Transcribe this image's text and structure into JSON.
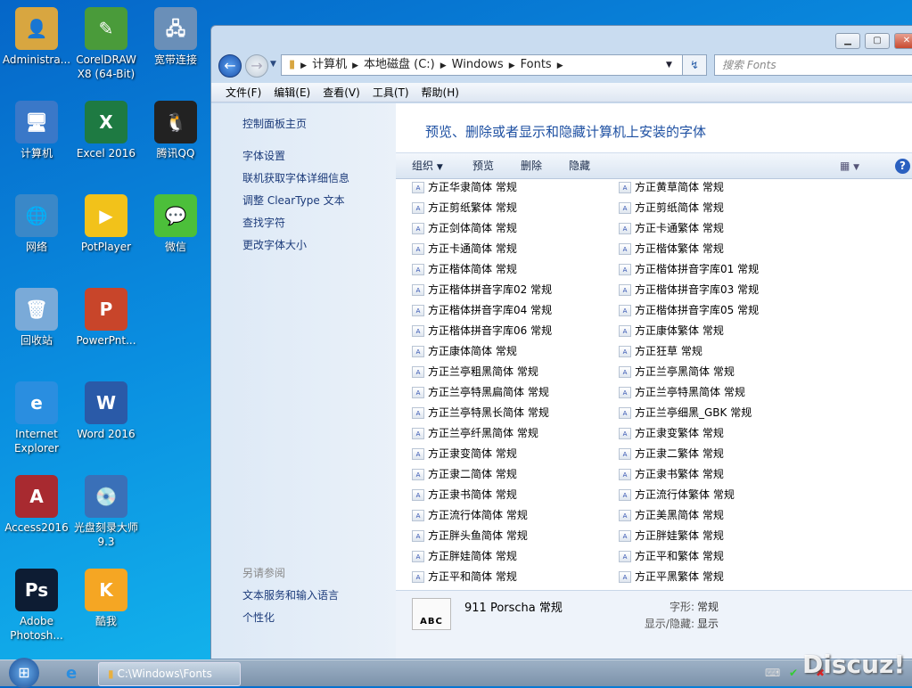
{
  "desktop": {
    "icons": [
      {
        "label": "Administra...",
        "icon": "user-folder-icon",
        "color": "#d8a640",
        "glyph": "👤"
      },
      {
        "label": "CorelDRAW X8 (64-Bit)",
        "icon": "coreldraw-icon",
        "color": "#4a9b3a",
        "glyph": "✎"
      },
      {
        "label": "宽带连接",
        "icon": "broadband-icon",
        "color": "#6a8fb8",
        "glyph": "🖧"
      },
      {
        "label": "计算机",
        "icon": "computer-icon",
        "color": "#3a78c8",
        "glyph": "🖥"
      },
      {
        "label": "Excel 2016",
        "icon": "excel-icon",
        "color": "#1e7a42",
        "glyph": "X"
      },
      {
        "label": "腾讯QQ",
        "icon": "qq-icon",
        "color": "#222",
        "glyph": "🐧"
      },
      {
        "label": "网络",
        "icon": "network-icon",
        "color": "#3a88c8",
        "glyph": "🌐"
      },
      {
        "label": "PotPlayer",
        "icon": "potplayer-icon",
        "color": "#f2c21a",
        "glyph": "▶"
      },
      {
        "label": "微信",
        "icon": "wechat-icon",
        "color": "#4cbf3a",
        "glyph": "💬"
      },
      {
        "label": "回收站",
        "icon": "recycle-bin-icon",
        "color": "#7aaad8",
        "glyph": "🗑"
      },
      {
        "label": "PowerPnt...",
        "icon": "powerpoint-icon",
        "color": "#c8452a",
        "glyph": "P"
      },
      {
        "label": "Internet Explorer",
        "icon": "ie-icon",
        "color": "#2a8ee0",
        "glyph": "e"
      },
      {
        "label": "Word 2016",
        "icon": "word-icon",
        "color": "#2a5aa8",
        "glyph": "W"
      },
      {
        "label": "Access2016",
        "icon": "access-icon",
        "color": "#a82a30",
        "glyph": "A"
      },
      {
        "label": "光盘刻录大师 9.3",
        "icon": "disc-burner-icon",
        "color": "#3a70b8",
        "glyph": "💿"
      },
      {
        "label": "Adobe Photosh...",
        "icon": "photoshop-icon",
        "color": "#0d1c33",
        "glyph": "Ps"
      },
      {
        "label": "酷我",
        "icon": "kuwo-icon",
        "color": "#f5a623",
        "glyph": "K"
      }
    ]
  },
  "window": {
    "nav": {
      "breadcrumb": [
        "计算机",
        "本地磁盘 (C:)",
        "Windows",
        "Fonts"
      ],
      "search_placeholder": "搜索 Fonts"
    },
    "menu": [
      "文件(F)",
      "编辑(E)",
      "查看(V)",
      "工具(T)",
      "帮助(H)"
    ],
    "left_links": [
      "控制面板主页",
      "字体设置",
      "联机获取字体详细信息",
      "调整 ClearType 文本",
      "查找字符",
      "更改字体大小"
    ],
    "see_also": {
      "title": "另请参阅",
      "links": [
        "文本服务和输入语言",
        "个性化"
      ]
    },
    "title": "预览、删除或者显示和隐藏计算机上安装的字体",
    "commands": {
      "organize": "组织",
      "preview": "预览",
      "delete": "删除",
      "hide": "隐藏"
    },
    "fonts": [
      [
        "方正华隶简体 常规",
        "方正黄草简体 常规"
      ],
      [
        "方正剪纸繁体 常规",
        "方正剪纸简体 常规"
      ],
      [
        "方正剑体简体 常规",
        "方正卡通繁体 常规"
      ],
      [
        "方正卡通简体 常规",
        "方正楷体繁体 常规"
      ],
      [
        "方正楷体简体 常规",
        "方正楷体拼音字库01 常规"
      ],
      [
        "方正楷体拼音字库02 常规",
        "方正楷体拼音字库03 常规"
      ],
      [
        "方正楷体拼音字库04 常规",
        "方正楷体拼音字库05 常规"
      ],
      [
        "方正楷体拼音字库06 常规",
        "方正康体繁体 常规"
      ],
      [
        "方正康体简体 常规",
        "方正狂草 常规"
      ],
      [
        "方正兰亭粗黑简体 常规",
        "方正兰亭黑简体 常规"
      ],
      [
        "方正兰亭特黑扁简体 常规",
        "方正兰亭特黑简体 常规"
      ],
      [
        "方正兰亭特黑长简体 常规",
        "方正兰亭细黑_GBK 常规"
      ],
      [
        "方正兰亭纤黑简体 常规",
        "方正隶变繁体 常规"
      ],
      [
        "方正隶变简体 常规",
        "方正隶二繁体 常规"
      ],
      [
        "方正隶二简体 常规",
        "方正隶书繁体 常规"
      ],
      [
        "方正隶书简体 常规",
        "方正流行体繁体 常规"
      ],
      [
        "方正流行体简体 常规",
        "方正美黑简体 常规"
      ],
      [
        "方正胖头鱼简体 常规",
        "方正胖娃繁体 常规"
      ],
      [
        "方正胖娃简体 常规",
        "方正平和繁体 常规"
      ],
      [
        "方正平和简体 常规",
        "方正平黑繁体 常规"
      ]
    ],
    "details": {
      "thumb": "ABC",
      "name": "911 Porscha 常规",
      "style_label": "字形:",
      "style_value": "常规",
      "visibility_label": "显示/隐藏:",
      "visibility_value": "显示"
    }
  },
  "taskbar": {
    "task": "C:\\Windows\\Fonts",
    "watermark": "Discuz!"
  }
}
